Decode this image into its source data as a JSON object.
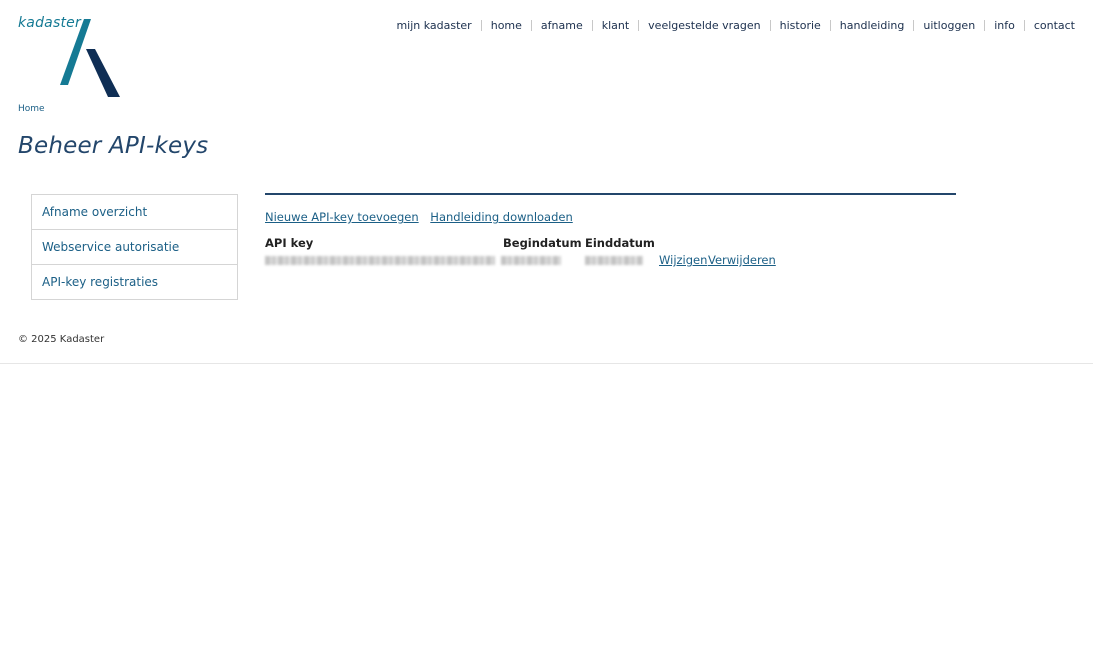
{
  "brand": {
    "logo_text": "kadaster",
    "colors": {
      "teal": "#157a94",
      "navy": "#23466b",
      "link": "#1b5f86"
    }
  },
  "topnav": {
    "items": [
      "mijn kadaster",
      "home",
      "afname",
      "klant",
      "veelgestelde vragen",
      "historie",
      "handleiding",
      "uitloggen",
      "info",
      "contact"
    ]
  },
  "breadcrumb": {
    "home": "Home"
  },
  "page": {
    "title": "Beheer API-keys"
  },
  "sidebar": {
    "items": [
      {
        "label": "Afname overzicht"
      },
      {
        "label": "Webservice autorisatie"
      },
      {
        "label": "API-key registraties"
      }
    ]
  },
  "actions": {
    "add_key": "Nieuwe API-key toevoegen",
    "download_manual": "Handleiding downloaden"
  },
  "table": {
    "headers": {
      "api_key": "API key",
      "begin": "Begindatum",
      "end": "Einddatum"
    },
    "rows": [
      {
        "edit": "Wijzigen",
        "delete": "Verwijderen"
      }
    ]
  },
  "footer": {
    "copyright": "© 2025 Kadaster"
  }
}
